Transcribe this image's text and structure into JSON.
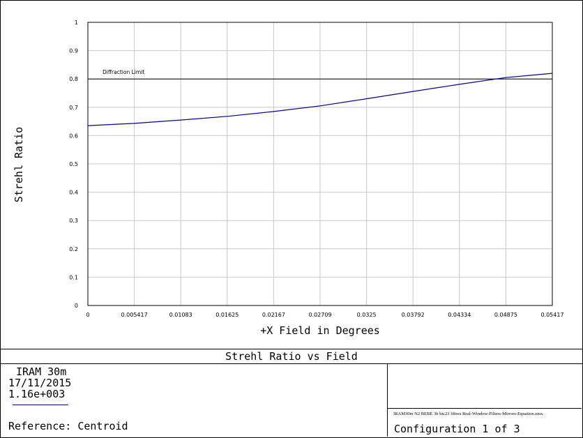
{
  "chart_data": {
    "type": "line",
    "title": "Strehl Ratio vs Field",
    "xlabel": "+X Field in Degrees",
    "ylabel": "Strehl Ratio",
    "xlim": [
      0,
      0.05417
    ],
    "ylim": [
      0,
      1
    ],
    "x_ticks": [
      "0",
      "0.005417",
      "0.01083",
      "0.01625",
      "0.02167",
      "0.02709",
      "0.0325",
      "0.03792",
      "0.04334",
      "0.04875",
      "0.05417"
    ],
    "y_ticks": [
      "0",
      "0.1",
      "0.2",
      "0.3",
      "0.4",
      "0.5",
      "0.6",
      "0.7",
      "0.8",
      "0.9",
      "1"
    ],
    "grid": true,
    "series": [
      {
        "color": "#00008b",
        "x": [
          0,
          0.005417,
          0.01083,
          0.01625,
          0.02167,
          0.02709,
          0.0325,
          0.03792,
          0.04334,
          0.04875,
          0.05417
        ],
        "y": [
          0.635,
          0.643,
          0.655,
          0.668,
          0.685,
          0.705,
          0.73,
          0.756,
          0.781,
          0.805,
          0.82
        ]
      }
    ],
    "reference_line": {
      "y": 0.8,
      "label": "Diffraction Limit",
      "color": "#000000"
    }
  },
  "info": {
    "telescope": "IRAM 30m",
    "date": "17/11/2015",
    "wavelength": "1.16e+003",
    "reference": "Reference: Centroid",
    "file": "IRAM30m N2 BEBE 3b hic23 filtres Real-Window-Filters-Mirrors-Equation.zmx",
    "configuration": "Configuration 1 of 3"
  }
}
